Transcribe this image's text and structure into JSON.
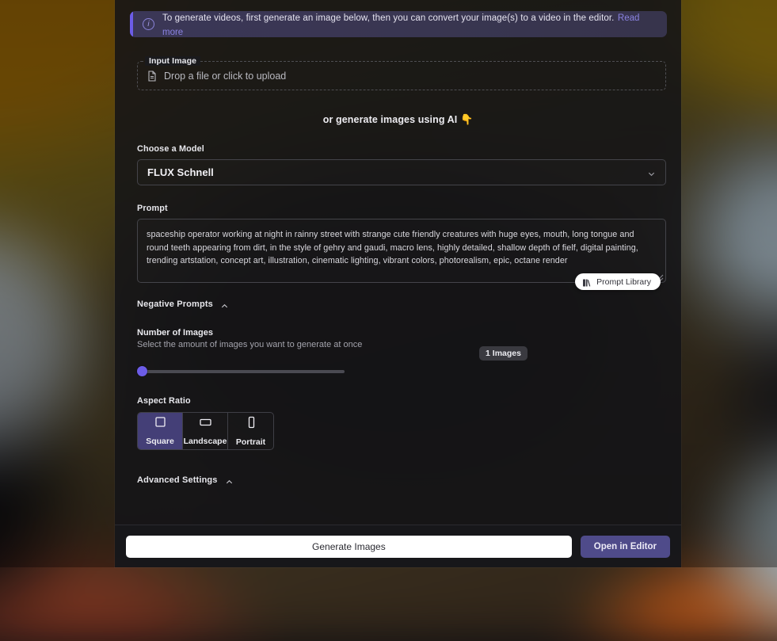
{
  "banner": {
    "icon": "info-circle-icon",
    "text": "To generate videos, first generate an image below, then you can convert your image(s) to a video in the editor.",
    "link_label": "Read more",
    "accent_color": "#6c5ce7",
    "background_color": "#393651",
    "link_color": "#8a82e0"
  },
  "input_image": {
    "legend": "Input Image",
    "placeholder": "Drop a file or click to upload",
    "icon": "file-icon"
  },
  "divider_text": "or generate images using AI",
  "divider_emoji": "👇",
  "model": {
    "label": "Choose a Model",
    "selected": "FLUX Schnell",
    "chevron": "chevron-down-icon"
  },
  "prompt": {
    "label": "Prompt",
    "value": "spaceship operator working at night in rainny street with strange cute friendly creatures with huge eyes, mouth, long tongue and round teeth appearing from dirt, in the style of gehry and gaudi, macro lens, highly detailed, shallow depth of fielf, digital painting, trending artstation, concept art, illustration, cinematic lighting, vibrant colors, photorealism, epic, octane render",
    "library_button": "Prompt Library",
    "library_icon": "book-icon"
  },
  "negative_prompts": {
    "label": "Negative Prompts",
    "caret": "chevron-up-icon"
  },
  "number_of_images": {
    "title": "Number of Images",
    "subtitle": "Select the amount of images you want to generate at once",
    "badge": "1 Images",
    "value": 1,
    "thumb_color": "#6c5ce7"
  },
  "aspect_ratio": {
    "label": "Aspect Ratio",
    "options": [
      {
        "label": "Square",
        "icon": "square-ratio-icon",
        "selected": true
      },
      {
        "label": "Landscape",
        "icon": "landscape-ratio-icon",
        "selected": false
      },
      {
        "label": "Portrait",
        "icon": "portrait-ratio-icon",
        "selected": false
      }
    ],
    "selected_color": "#443f77"
  },
  "advanced_settings": {
    "label": "Advanced Settings",
    "caret": "chevron-up-icon"
  },
  "actions": {
    "generate_label": "Generate Images",
    "editor_label": "Open in Editor",
    "editor_color": "#4f4b8a"
  }
}
